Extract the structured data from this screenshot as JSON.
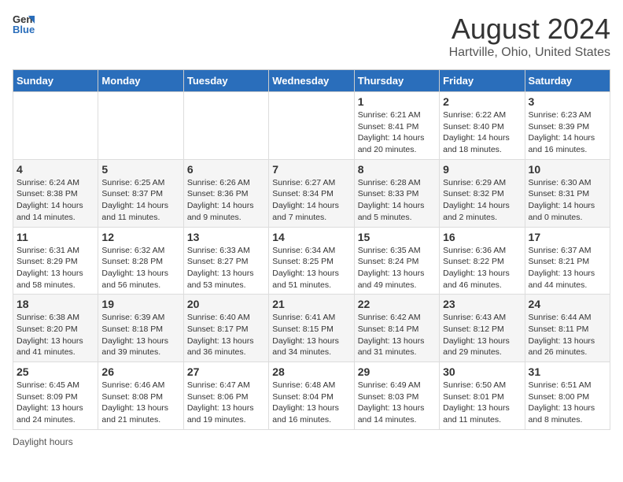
{
  "logo": {
    "general": "General",
    "blue": "Blue"
  },
  "title": "August 2024",
  "subtitle": "Hartville, Ohio, United States",
  "days_of_week": [
    "Sunday",
    "Monday",
    "Tuesday",
    "Wednesday",
    "Thursday",
    "Friday",
    "Saturday"
  ],
  "footer": {
    "daylight_label": "Daylight hours"
  },
  "weeks": [
    [
      {
        "num": "",
        "sunrise": "",
        "sunset": "",
        "daylight": "",
        "empty": true
      },
      {
        "num": "",
        "sunrise": "",
        "sunset": "",
        "daylight": "",
        "empty": true
      },
      {
        "num": "",
        "sunrise": "",
        "sunset": "",
        "daylight": "",
        "empty": true
      },
      {
        "num": "",
        "sunrise": "",
        "sunset": "",
        "daylight": "",
        "empty": true
      },
      {
        "num": "1",
        "sunrise": "Sunrise: 6:21 AM",
        "sunset": "Sunset: 8:41 PM",
        "daylight": "Daylight: 14 hours and 20 minutes."
      },
      {
        "num": "2",
        "sunrise": "Sunrise: 6:22 AM",
        "sunset": "Sunset: 8:40 PM",
        "daylight": "Daylight: 14 hours and 18 minutes."
      },
      {
        "num": "3",
        "sunrise": "Sunrise: 6:23 AM",
        "sunset": "Sunset: 8:39 PM",
        "daylight": "Daylight: 14 hours and 16 minutes."
      }
    ],
    [
      {
        "num": "4",
        "sunrise": "Sunrise: 6:24 AM",
        "sunset": "Sunset: 8:38 PM",
        "daylight": "Daylight: 14 hours and 14 minutes."
      },
      {
        "num": "5",
        "sunrise": "Sunrise: 6:25 AM",
        "sunset": "Sunset: 8:37 PM",
        "daylight": "Daylight: 14 hours and 11 minutes."
      },
      {
        "num": "6",
        "sunrise": "Sunrise: 6:26 AM",
        "sunset": "Sunset: 8:36 PM",
        "daylight": "Daylight: 14 hours and 9 minutes."
      },
      {
        "num": "7",
        "sunrise": "Sunrise: 6:27 AM",
        "sunset": "Sunset: 8:34 PM",
        "daylight": "Daylight: 14 hours and 7 minutes."
      },
      {
        "num": "8",
        "sunrise": "Sunrise: 6:28 AM",
        "sunset": "Sunset: 8:33 PM",
        "daylight": "Daylight: 14 hours and 5 minutes."
      },
      {
        "num": "9",
        "sunrise": "Sunrise: 6:29 AM",
        "sunset": "Sunset: 8:32 PM",
        "daylight": "Daylight: 14 hours and 2 minutes."
      },
      {
        "num": "10",
        "sunrise": "Sunrise: 6:30 AM",
        "sunset": "Sunset: 8:31 PM",
        "daylight": "Daylight: 14 hours and 0 minutes."
      }
    ],
    [
      {
        "num": "11",
        "sunrise": "Sunrise: 6:31 AM",
        "sunset": "Sunset: 8:29 PM",
        "daylight": "Daylight: 13 hours and 58 minutes."
      },
      {
        "num": "12",
        "sunrise": "Sunrise: 6:32 AM",
        "sunset": "Sunset: 8:28 PM",
        "daylight": "Daylight: 13 hours and 56 minutes."
      },
      {
        "num": "13",
        "sunrise": "Sunrise: 6:33 AM",
        "sunset": "Sunset: 8:27 PM",
        "daylight": "Daylight: 13 hours and 53 minutes."
      },
      {
        "num": "14",
        "sunrise": "Sunrise: 6:34 AM",
        "sunset": "Sunset: 8:25 PM",
        "daylight": "Daylight: 13 hours and 51 minutes."
      },
      {
        "num": "15",
        "sunrise": "Sunrise: 6:35 AM",
        "sunset": "Sunset: 8:24 PM",
        "daylight": "Daylight: 13 hours and 49 minutes."
      },
      {
        "num": "16",
        "sunrise": "Sunrise: 6:36 AM",
        "sunset": "Sunset: 8:22 PM",
        "daylight": "Daylight: 13 hours and 46 minutes."
      },
      {
        "num": "17",
        "sunrise": "Sunrise: 6:37 AM",
        "sunset": "Sunset: 8:21 PM",
        "daylight": "Daylight: 13 hours and 44 minutes."
      }
    ],
    [
      {
        "num": "18",
        "sunrise": "Sunrise: 6:38 AM",
        "sunset": "Sunset: 8:20 PM",
        "daylight": "Daylight: 13 hours and 41 minutes."
      },
      {
        "num": "19",
        "sunrise": "Sunrise: 6:39 AM",
        "sunset": "Sunset: 8:18 PM",
        "daylight": "Daylight: 13 hours and 39 minutes."
      },
      {
        "num": "20",
        "sunrise": "Sunrise: 6:40 AM",
        "sunset": "Sunset: 8:17 PM",
        "daylight": "Daylight: 13 hours and 36 minutes."
      },
      {
        "num": "21",
        "sunrise": "Sunrise: 6:41 AM",
        "sunset": "Sunset: 8:15 PM",
        "daylight": "Daylight: 13 hours and 34 minutes."
      },
      {
        "num": "22",
        "sunrise": "Sunrise: 6:42 AM",
        "sunset": "Sunset: 8:14 PM",
        "daylight": "Daylight: 13 hours and 31 minutes."
      },
      {
        "num": "23",
        "sunrise": "Sunrise: 6:43 AM",
        "sunset": "Sunset: 8:12 PM",
        "daylight": "Daylight: 13 hours and 29 minutes."
      },
      {
        "num": "24",
        "sunrise": "Sunrise: 6:44 AM",
        "sunset": "Sunset: 8:11 PM",
        "daylight": "Daylight: 13 hours and 26 minutes."
      }
    ],
    [
      {
        "num": "25",
        "sunrise": "Sunrise: 6:45 AM",
        "sunset": "Sunset: 8:09 PM",
        "daylight": "Daylight: 13 hours and 24 minutes."
      },
      {
        "num": "26",
        "sunrise": "Sunrise: 6:46 AM",
        "sunset": "Sunset: 8:08 PM",
        "daylight": "Daylight: 13 hours and 21 minutes."
      },
      {
        "num": "27",
        "sunrise": "Sunrise: 6:47 AM",
        "sunset": "Sunset: 8:06 PM",
        "daylight": "Daylight: 13 hours and 19 minutes."
      },
      {
        "num": "28",
        "sunrise": "Sunrise: 6:48 AM",
        "sunset": "Sunset: 8:04 PM",
        "daylight": "Daylight: 13 hours and 16 minutes."
      },
      {
        "num": "29",
        "sunrise": "Sunrise: 6:49 AM",
        "sunset": "Sunset: 8:03 PM",
        "daylight": "Daylight: 13 hours and 14 minutes."
      },
      {
        "num": "30",
        "sunrise": "Sunrise: 6:50 AM",
        "sunset": "Sunset: 8:01 PM",
        "daylight": "Daylight: 13 hours and 11 minutes."
      },
      {
        "num": "31",
        "sunrise": "Sunrise: 6:51 AM",
        "sunset": "Sunset: 8:00 PM",
        "daylight": "Daylight: 13 hours and 8 minutes."
      }
    ]
  ]
}
